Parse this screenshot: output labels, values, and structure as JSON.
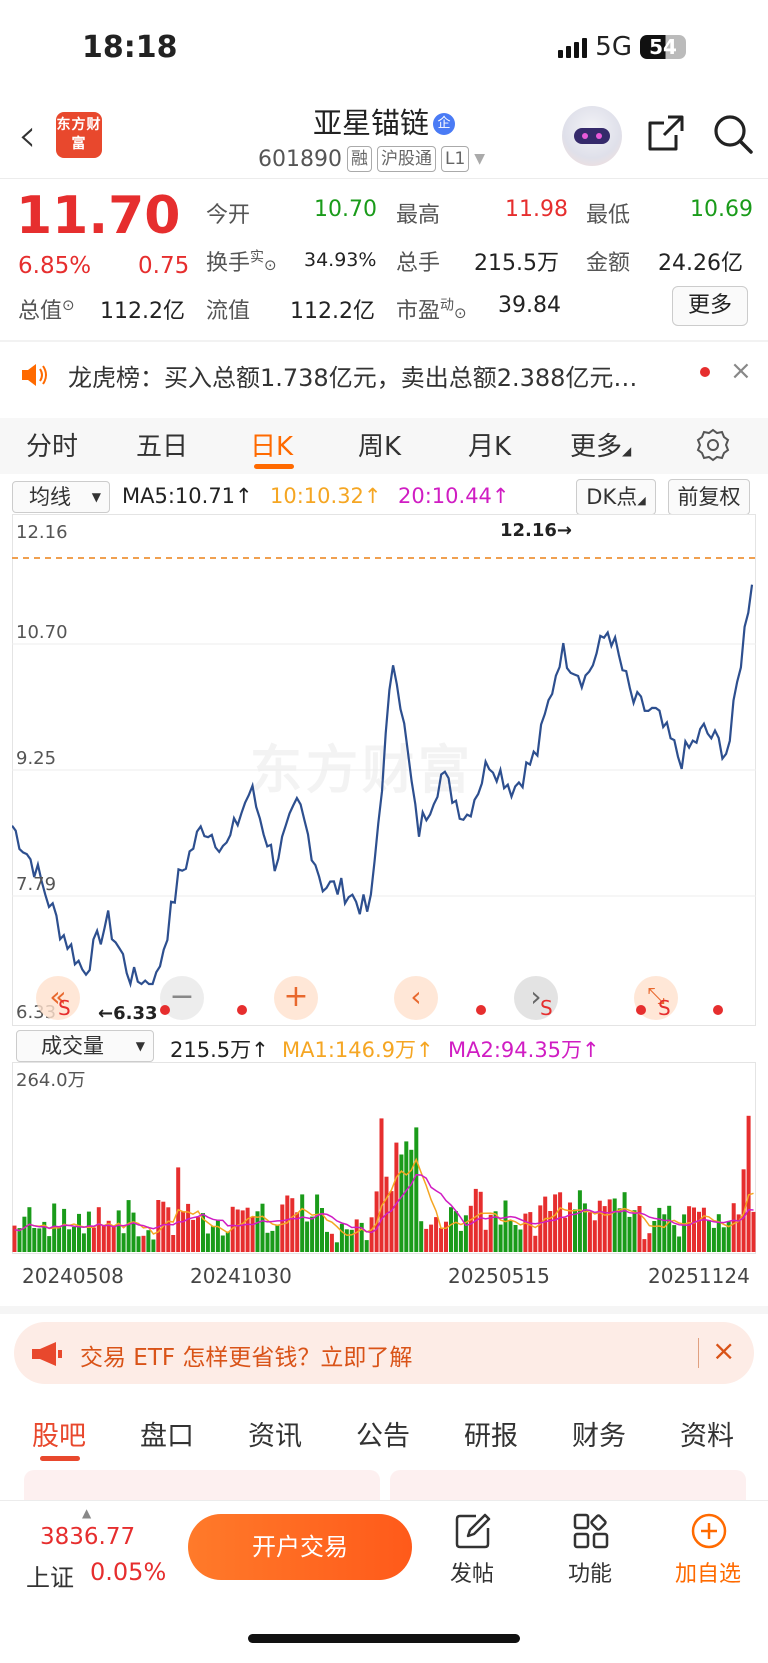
{
  "status": {
    "time": "18:18",
    "network": "5G",
    "battery": "54"
  },
  "header": {
    "logo": "东方财富",
    "stock_name": "亚星锚链",
    "name_badge": "企",
    "stock_code": "601890",
    "tags": [
      "融",
      "沪股通",
      "L1"
    ]
  },
  "quote": {
    "price": "11.70",
    "change_pct": "6.85%",
    "change": "0.75",
    "fields": {
      "open_label": "今开",
      "open": "10.70",
      "high_label": "最高",
      "high": "11.98",
      "low_label": "最低",
      "low": "10.69",
      "turnover_label": "换手",
      "turnover_sup": "实",
      "turnover": "34.93%",
      "volume_label": "总手",
      "volume": "215.5万",
      "amount_label": "金额",
      "amount": "24.26亿",
      "mktcap_label": "总值",
      "mktcap": "112.2亿",
      "float_label": "流值",
      "float": "112.2亿",
      "pe_label": "市盈",
      "pe_sup": "动",
      "pe": "39.84"
    },
    "more_label": "更多"
  },
  "dragon_board": {
    "text": "龙虎榜：买入总额1.738亿元，卖出总额2.388亿元…"
  },
  "chart_tabs": [
    "分时",
    "五日",
    "日K",
    "周K",
    "月K",
    "更多"
  ],
  "chart_tab_active": 2,
  "ma_row": {
    "selector": "均线",
    "ma5": "MA5:10.71↑",
    "ma10": "10:10.32↑",
    "ma20": "20:10.44↑",
    "dk_label": "DK点",
    "adjust_label": "前复权"
  },
  "kline": {
    "y_labels": [
      "12.16",
      "10.70",
      "9.25",
      "7.79",
      "6.33"
    ],
    "high_marker": "12.16→",
    "low_marker": "←6.33",
    "watermark": "东方财富",
    "signal_s": "S"
  },
  "volume": {
    "selector": "成交量",
    "value": "215.5万↑",
    "ma1": "MA1:146.9万↑",
    "ma2": "MA2:94.35万↑",
    "y_max": "264.0万"
  },
  "x_dates": [
    "20240508",
    "20241030",
    "20250515",
    "20251124"
  ],
  "chart_data": {
    "type": "line",
    "title": "",
    "xlabel": "",
    "ylabel": "",
    "ylim": [
      6.33,
      12.16
    ],
    "x": [
      "20240508",
      "20241030",
      "20250515",
      "20251124"
    ],
    "series": [
      {
        "values": [
          8.5,
          7.9,
          7.1,
          6.5,
          7.2,
          6.4,
          6.33,
          7.8,
          8.5,
          8.2,
          9.0,
          8.0,
          8.8,
          7.7,
          7.6,
          7.3,
          10.9,
          8.4,
          9.2,
          8.6,
          9.4,
          9.0,
          9.5,
          10.9,
          10.5,
          11.2,
          10.2,
          10.0,
          9.4,
          9.8,
          9.5,
          11.9
        ]
      }
    ],
    "colors": {
      "line": "#2d4f8f"
    }
  },
  "promo": {
    "text": "交易 ETF 怎样更省钱？立即了解"
  },
  "section_tabs": [
    "股吧",
    "盘口",
    "资讯",
    "公告",
    "研报",
    "财务",
    "资料"
  ],
  "bottom": {
    "index_value": "3836.77",
    "index_name": "上证",
    "index_pct": "0.05%",
    "trade_label": "开户交易",
    "post_label": "发帖",
    "func_label": "功能",
    "add_label": "加自选"
  }
}
